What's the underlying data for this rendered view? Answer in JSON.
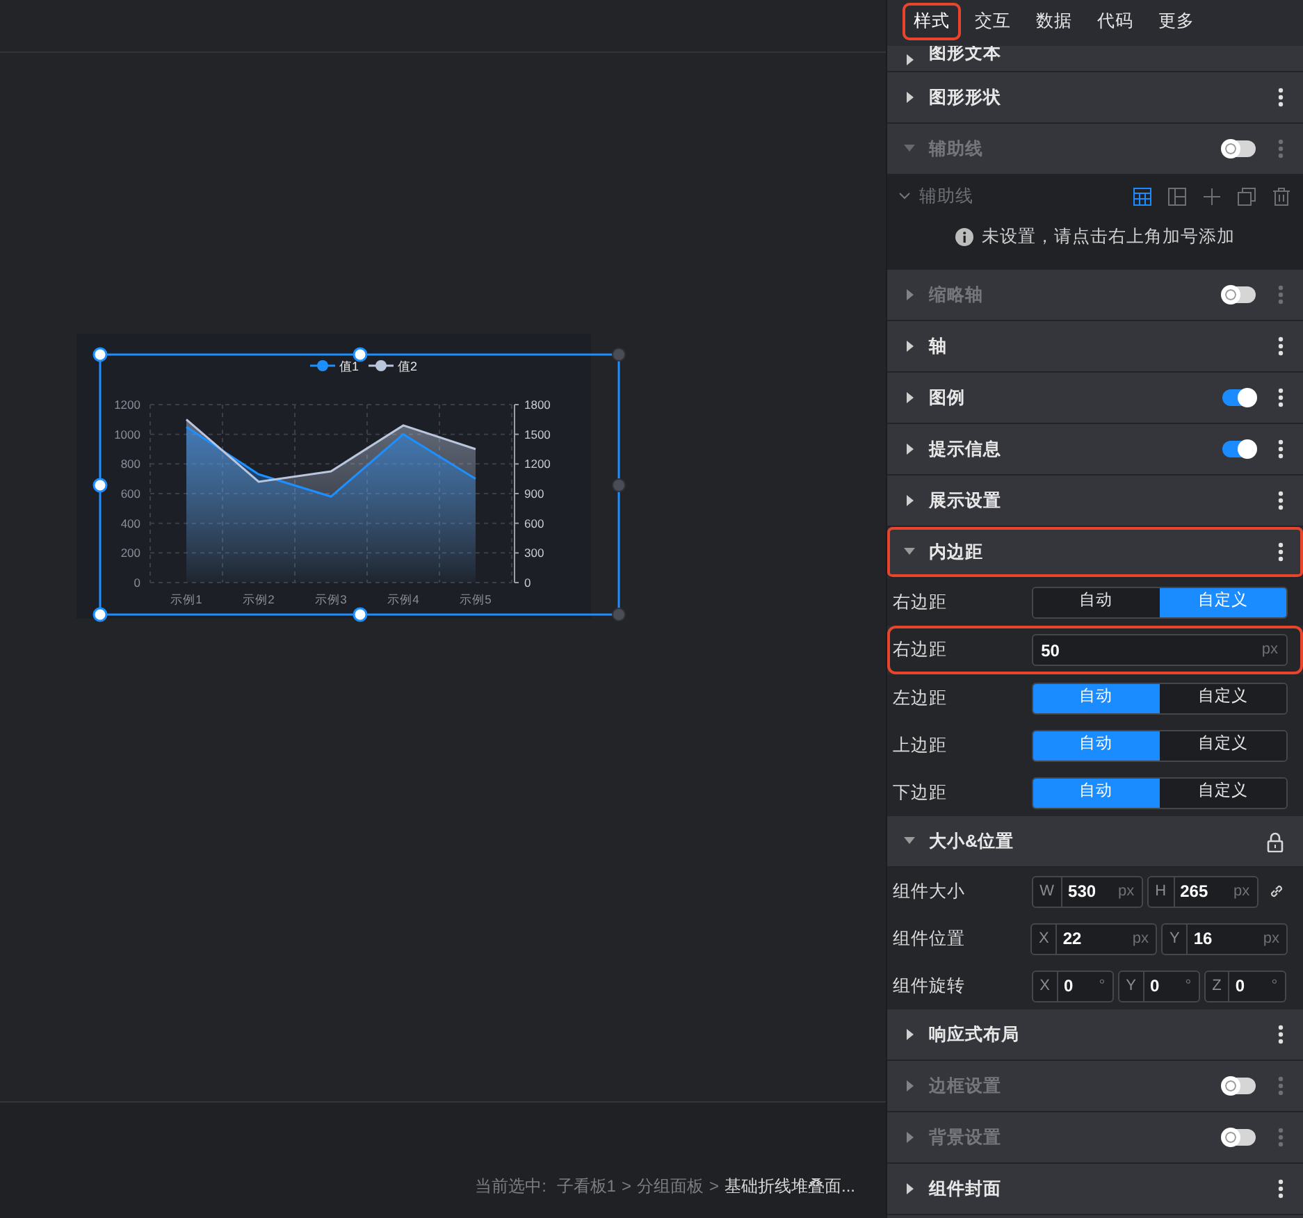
{
  "canvas": {
    "chart": {
      "right_axis_ticks": [
        "1800",
        "1500",
        "1200",
        "900",
        "600",
        "300",
        "0"
      ],
      "chart_data": {
        "type": "area",
        "grid": true,
        "legend": true,
        "categories": [
          "示例1",
          "示例2",
          "示例3",
          "示例4",
          "示例5"
        ],
        "series": [
          {
            "name": "值1",
            "color": "#1e8fff",
            "values": [
              1050,
              730,
              580,
              1000,
              700
            ]
          },
          {
            "name": "值2",
            "color": "#b9c6de",
            "values": [
              1100,
              680,
              750,
              1060,
              900
            ]
          }
        ],
        "ylim": [
          0,
          1200
        ],
        "yticks": [
          0,
          200,
          400,
          600,
          800,
          1000,
          1200
        ]
      }
    }
  },
  "status_bar": {
    "prefix": "当前选中:",
    "path": [
      {
        "label": "子看板1",
        "current": false
      },
      {
        "label": ">",
        "current": false
      },
      {
        "label": "分组面板",
        "current": false
      },
      {
        "label": ">",
        "current": false
      },
      {
        "label": "基础折线堆叠面...",
        "current": true
      }
    ]
  },
  "panel": {
    "tabs": [
      {
        "label": "样式",
        "selected": true,
        "highlighted": true
      },
      {
        "label": "交互",
        "selected": false,
        "highlighted": false
      },
      {
        "label": "数据",
        "selected": false,
        "highlighted": false
      },
      {
        "label": "代码",
        "selected": false,
        "highlighted": false
      },
      {
        "label": "更多",
        "selected": false,
        "highlighted": false
      }
    ],
    "items": [
      {
        "kind": "section",
        "title": "图形文本",
        "expanded": false,
        "partial": true
      },
      {
        "kind": "section",
        "title": "图形形状",
        "expanded": false
      },
      {
        "kind": "section",
        "title": "辅助线",
        "expanded": true,
        "toggle": false
      },
      {
        "kind": "sublist",
        "title": "辅助线",
        "tools": [
          {
            "selected": true
          },
          {
            "selected": false
          },
          {
            "selected": false
          },
          {
            "selected": false
          },
          {
            "selected": false
          }
        ],
        "empty_text": "未设置，请点击右上角加号添加"
      },
      {
        "kind": "section",
        "title": "缩略轴",
        "expanded": false,
        "toggle": false
      },
      {
        "kind": "section",
        "title": "轴",
        "expanded": false
      },
      {
        "kind": "section",
        "title": "图例",
        "expanded": false,
        "toggle": true
      },
      {
        "kind": "section",
        "title": "提示信息",
        "expanded": false,
        "toggle": true
      },
      {
        "kind": "section",
        "title": "展示设置",
        "expanded": false
      },
      {
        "kind": "section",
        "title": "内边距",
        "expanded": true,
        "highlighted": true
      },
      {
        "kind": "segmented",
        "label": "右边距",
        "options": [
          {
            "label": "自动",
            "selected": false
          },
          {
            "label": "自定义",
            "selected": true
          }
        ]
      },
      {
        "kind": "input",
        "label": "右边距",
        "value": "50",
        "unit": "px",
        "highlighted": true
      },
      {
        "kind": "segmented",
        "label": "左边距",
        "options": [
          {
            "label": "自动",
            "selected": true
          },
          {
            "label": "自定义",
            "selected": false
          }
        ]
      },
      {
        "kind": "segmented",
        "label": "上边距",
        "options": [
          {
            "label": "自动",
            "selected": true
          },
          {
            "label": "自定义",
            "selected": false
          }
        ]
      },
      {
        "kind": "segmented",
        "label": "下边距",
        "options": [
          {
            "label": "自动",
            "selected": true
          },
          {
            "label": "自定义",
            "selected": false
          }
        ]
      },
      {
        "kind": "section",
        "title": "大小&位置",
        "expanded": true,
        "locked": true
      },
      {
        "kind": "fields",
        "label": "组件大小",
        "linked": true,
        "fields": [
          {
            "prefix": "W",
            "value": "530",
            "unit": "px"
          },
          {
            "prefix": "H",
            "value": "265",
            "unit": "px"
          }
        ]
      },
      {
        "kind": "fields",
        "label": "组件位置",
        "fields": [
          {
            "prefix": "X",
            "value": "22",
            "unit": "px"
          },
          {
            "prefix": "Y",
            "value": "16",
            "unit": "px"
          }
        ]
      },
      {
        "kind": "fields",
        "label": "组件旋转",
        "fields": [
          {
            "prefix": "X",
            "value": "0",
            "unit": "°"
          },
          {
            "prefix": "Y",
            "value": "0",
            "unit": "°"
          },
          {
            "prefix": "Z",
            "value": "0",
            "unit": "°"
          }
        ]
      },
      {
        "kind": "section",
        "title": "响应式布局",
        "expanded": false
      },
      {
        "kind": "section",
        "title": "边框设置",
        "expanded": false,
        "toggle": false
      },
      {
        "kind": "section",
        "title": "背景设置",
        "expanded": false,
        "toggle": false
      },
      {
        "kind": "section",
        "title": "组件封面",
        "expanded": false
      }
    ]
  }
}
